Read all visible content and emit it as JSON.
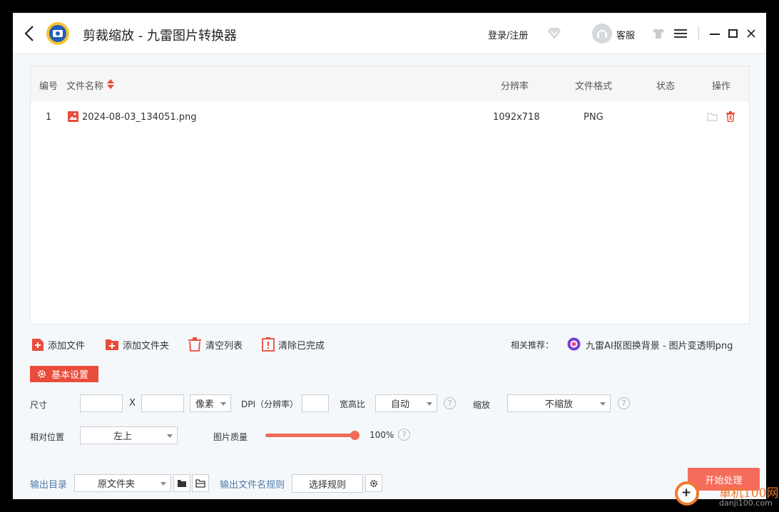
{
  "title_bar": {
    "title": "剪裁缩放 - 九雷图片转换器",
    "login_label": "登录/注册",
    "customer_service_label": "客服",
    "icons": [
      "back-icon",
      "app-logo",
      "vip-diamond-icon",
      "avatar",
      "skin-icon",
      "menu-icon",
      "minimize-icon",
      "maximize-icon",
      "close-icon"
    ]
  },
  "table": {
    "headers": {
      "index": "编号",
      "filename": "文件名称",
      "resolution": "分辨率",
      "format": "文件格式",
      "status": "状态",
      "actions": "操作"
    },
    "rows": [
      {
        "index": "1",
        "filename": "2024-08-03_134051.png",
        "resolution": "1092x718",
        "format": "PNG",
        "status": ""
      }
    ]
  },
  "toolbar": {
    "add_file": "添加文件",
    "add_folder": "添加文件夹",
    "clear_list": "清空列表",
    "clear_done": "清除已完成",
    "recommend_label": "相关推荐：",
    "recommend_link": "九雷AI抠图换背景 - 图片变透明png"
  },
  "settings": {
    "tag_label": "基本设置",
    "size_label": "尺寸",
    "size_width": "",
    "x_label": "X",
    "size_height": "",
    "unit_selected": "像素",
    "dpi_label": "DPI（分辨率）",
    "dpi_value": "",
    "ratio_label": "宽高比",
    "ratio_selected": "自动",
    "scale_label": "缩放",
    "scale_selected": "不缩放",
    "position_label": "相对位置",
    "position_selected": "左上",
    "quality_label": "图片质量",
    "quality_percent": 100,
    "quality_text": "100%",
    "help_glyph": "?"
  },
  "output": {
    "dir_label": "输出目录",
    "dir_selected": "原文件夹",
    "rule_label": "输出文件名规则",
    "rule_button": "选择规则",
    "start_button": "开始处理"
  },
  "watermark": {
    "site_name": "單机100网",
    "site_url": "danji100.com"
  },
  "colors": {
    "accent": "#ea4c3b",
    "start_button": "#f56c5b",
    "link_blue": "#4f7aa8",
    "slider": "#f06a5a",
    "watermark_orange": "#ef7a2a"
  }
}
